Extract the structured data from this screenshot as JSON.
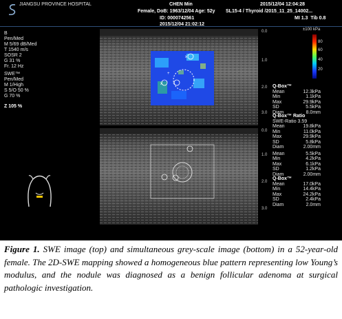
{
  "header": {
    "hospital": "JIANGSU PROVINCE HOSPITAL",
    "patient_name": "CHEN Min",
    "patient_info": "Female, DoB: 1963/12/04 Age: 52y",
    "patient_id": "ID: 0000742561",
    "datetime": "2015/12/04 12:04:28",
    "probe_info": "SL15-4 / Thyroid /2015_11_25_14002...",
    "mi_tib": "MI 1.3  Tib 0.8"
  },
  "image_datetime": "2015/12/04 21:02:12",
  "left_params_b": [
    "B",
    "Pen/Med",
    "M 5/69 dB/Med",
    "T 1540 m/s",
    "SOSR 2",
    "G 31 %",
    "Fr. 12 Hz"
  ],
  "left_params_swe": [
    "SWE™",
    "Pen/Med",
    "M 1/High",
    "S 5/O 50 %",
    "G 70 %"
  ],
  "zoom": "Z 105 %",
  "colorbar": {
    "unit": "±100 kPa",
    "labels": [
      "80",
      "60",
      "40",
      "20"
    ]
  },
  "depth_top": [
    "0.0",
    "1.0",
    "2.0",
    "3.0"
  ],
  "depth_bottom": [
    "0.0",
    "1.0",
    "2.0",
    "3.0"
  ],
  "qbox1": {
    "title": "Q-Box™",
    "rows": [
      [
        "Mean",
        "12.3kPa"
      ],
      [
        "Min",
        "1.1kPa"
      ],
      [
        "Max",
        "29.9kPa"
      ],
      [
        "SD",
        "5.5kPa"
      ],
      [
        "Diam",
        "8.0mm"
      ]
    ]
  },
  "qbox_ratio": {
    "title": "Q-Box™ Ratio",
    "ratio": "SWE-Ratio 3.59",
    "rows": [
      [
        "Mean",
        "19.8kPa"
      ],
      [
        "Min",
        "11.0kPa"
      ],
      [
        "Max",
        "29.9kPa"
      ],
      [
        "SD",
        "5.8kPa"
      ],
      [
        "Diam",
        "2.00mm"
      ],
      [
        "Mean",
        "5.5kPa"
      ],
      [
        "Min",
        "4.2kPa"
      ],
      [
        "Max",
        "6.1kPa"
      ],
      [
        "SD",
        "1.2kPa"
      ],
      [
        "Diam",
        "2.00mm"
      ]
    ]
  },
  "qbox2": {
    "title": "Q-Box™",
    "rows": [
      [
        "Mean",
        "17.0kPa"
      ],
      [
        "Min",
        "14.4kPa"
      ],
      [
        "Max",
        "24.2kPa"
      ],
      [
        "SD",
        "2.4kPa"
      ],
      [
        "Diam",
        "2.0mm"
      ]
    ]
  },
  "caption": {
    "label": "Figure 1.",
    "text": " SWE image (top) and simultaneous grey-scale image (bottom) in a 52-year-old female. The 2D-SWE mapping showed a homogeneous blue pattern representing low Young’s modulus, and the nodule was diagnosed as a benign follicular adenoma at surgical pathologic investigation."
  }
}
